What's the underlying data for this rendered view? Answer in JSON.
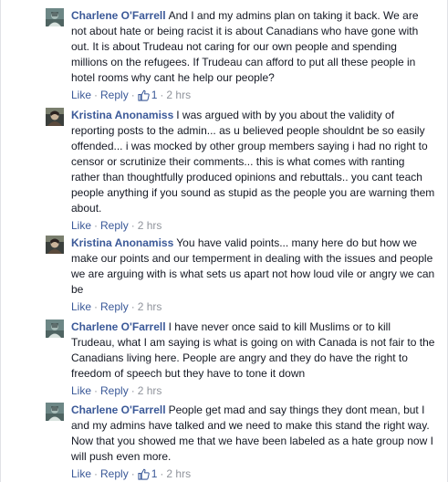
{
  "comments": [
    {
      "author": "Charlene O'Farrell",
      "text": "And I and my admins plan on taking it back. We are not about hate or being racist it is about Canadians who have gone with out. It is about Trudeau not caring for our own people and spending millions on the refugees. If Trudeau can afford to put all these people in hotel rooms why cant he help our people?",
      "like_label": "Like",
      "reply_label": "Reply",
      "likes": "1",
      "time": "2 hrs",
      "avatar_icon": "profile-avatar-teal"
    },
    {
      "author": "Kristina Anonamiss",
      "text": "I was argued with by you about the validity of reporting posts to the admin... as u believed people shouldnt be so easily offended... i was mocked by other group members saying i had no right to censor or scrutinize their comments... this is what comes with ranting rather than thoughtfully produced opinions and rebuttals.. you cant teach people anything if you sound as stupid as the people you are warning them about.",
      "like_label": "Like",
      "reply_label": "Reply",
      "time": "2 hrs",
      "avatar_icon": "profile-avatar-photo"
    },
    {
      "author": "Kristina Anonamiss",
      "text": "You have valid points... many here do but how we make our points and our temperment in dealing with the issues and people we are arguing with is what sets us apart not how loud vile or angry we can be",
      "like_label": "Like",
      "reply_label": "Reply",
      "time": "2 hrs",
      "avatar_icon": "profile-avatar-photo"
    },
    {
      "author": "Charlene O'Farrell",
      "text": "I have never once said to kill Muslims or to kill Trudeau, what I am saying is what is going on with Canada is not fair to the Canadians living here. People are angry and they do have the right to freedom of speech but they have to tone it down",
      "like_label": "Like",
      "reply_label": "Reply",
      "time": "2 hrs",
      "avatar_icon": "profile-avatar-teal"
    },
    {
      "author": "Charlene O'Farrell",
      "text": "People get mad and say things they dont mean, but I and my admins have talked and we need to make this stand the right way. Now that you showed me that we have been labeled as a hate group now I will push even more.",
      "like_label": "Like",
      "reply_label": "Reply",
      "likes": "1",
      "time": "2 hrs",
      "avatar_icon": "profile-avatar-teal"
    }
  ],
  "colors": {
    "link": "#3b5998",
    "text": "#141823",
    "meta": "#90949c"
  }
}
